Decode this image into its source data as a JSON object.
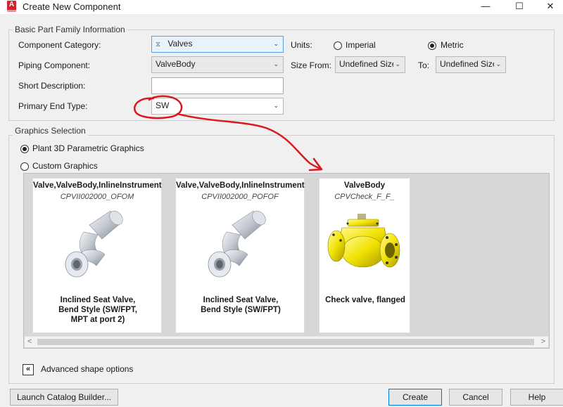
{
  "window": {
    "title": "Create New Component",
    "app_icon_letter": "A",
    "minimize_glyph": "—",
    "maximize_glyph": "☐",
    "close_glyph": "✕"
  },
  "basic_info": {
    "group_label": "Basic Part Family Information",
    "component_category_label": "Component Category:",
    "component_category_value": "Valves",
    "piping_component_label": "Piping Component:",
    "piping_component_value": "ValveBody",
    "short_description_label": "Short Description:",
    "short_description_value": "",
    "primary_end_type_label": "Primary End Type:",
    "primary_end_type_value": "SW",
    "units_label": "Units:",
    "units_options": [
      "Imperial",
      "Metric"
    ],
    "units_selected": "Metric",
    "size_from_label": "Size From:",
    "size_from_value": "Undefined Size",
    "to_label": "To:",
    "to_value": "Undefined Size"
  },
  "graphics": {
    "group_label": "Graphics Selection",
    "option_parametric": "Plant 3D Parametric Graphics",
    "option_custom": "Custom Graphics",
    "selected": "Plant 3D Parametric Graphics",
    "cards": [
      {
        "title": "Valve,ValveBody,InlineInstrument",
        "subtitle": "CPVII002000_OFOM",
        "desc_lines": [
          "Inclined Seat Valve,",
          "Bend Style (SW/FPT,",
          "MPT at port 2)"
        ],
        "render": "inclined-seat-valve"
      },
      {
        "title": "Valve,ValveBody,InlineInstrument",
        "subtitle": "CPVII002000_POFOF",
        "desc_lines": [
          "Inclined Seat Valve,",
          "Bend Style (SW/FPT)"
        ],
        "render": "inclined-seat-valve"
      },
      {
        "title": "ValveBody",
        "subtitle": "CPVCheck_F_F_",
        "desc_lines": [
          "Check valve, flanged"
        ],
        "render": "check-valve-flanged"
      }
    ],
    "scroll_left_glyph": "<",
    "scroll_right_glyph": ">"
  },
  "advanced": {
    "toggle_glyph": "«",
    "label": "Advanced shape options"
  },
  "footer": {
    "launch_catalog_builder": "Launch Catalog Builder...",
    "create": "Create",
    "cancel": "Cancel",
    "help": "Help"
  },
  "colors": {
    "accent": "#0078d7",
    "autodesk_red": "#d2232a",
    "annotation_red": "#d9181f",
    "valve_silver": "#c4cad1",
    "check_valve_yellow": "#f2e200"
  }
}
